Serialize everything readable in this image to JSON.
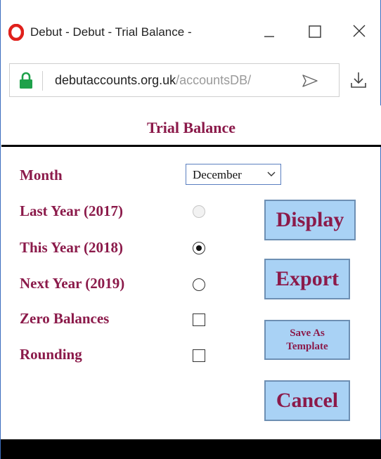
{
  "window": {
    "title": "Debut - Debut - Trial Balance - ",
    "url_host": "debutaccounts.org.uk",
    "url_path": "/accountsDB/"
  },
  "page": {
    "heading": "Trial Balance"
  },
  "form": {
    "month_label": "Month",
    "month_value": "December",
    "last_year_label": "Last Year (2017)",
    "this_year_label": "This Year (2018)",
    "next_year_label": "Next Year (2019)",
    "zero_balances_label": "Zero Balances",
    "rounding_label": "Rounding",
    "selected_year": "This Year (2018)",
    "zero_balances_checked": false,
    "rounding_checked": false
  },
  "buttons": {
    "display": "Display",
    "export": "Export",
    "save_as_template_line1": "Save As",
    "save_as_template_line2": "Template",
    "cancel": "Cancel"
  },
  "colors": {
    "label": "#8b1a4a",
    "button_bg": "#a9d2f5",
    "opera_red": "#e0201b",
    "lock_green": "#1ea14a"
  },
  "icons": [
    "opera-logo-icon",
    "minimize-icon",
    "maximize-icon",
    "close-icon",
    "lock-icon",
    "send-icon",
    "download-icon",
    "chevron-down-icon"
  ]
}
